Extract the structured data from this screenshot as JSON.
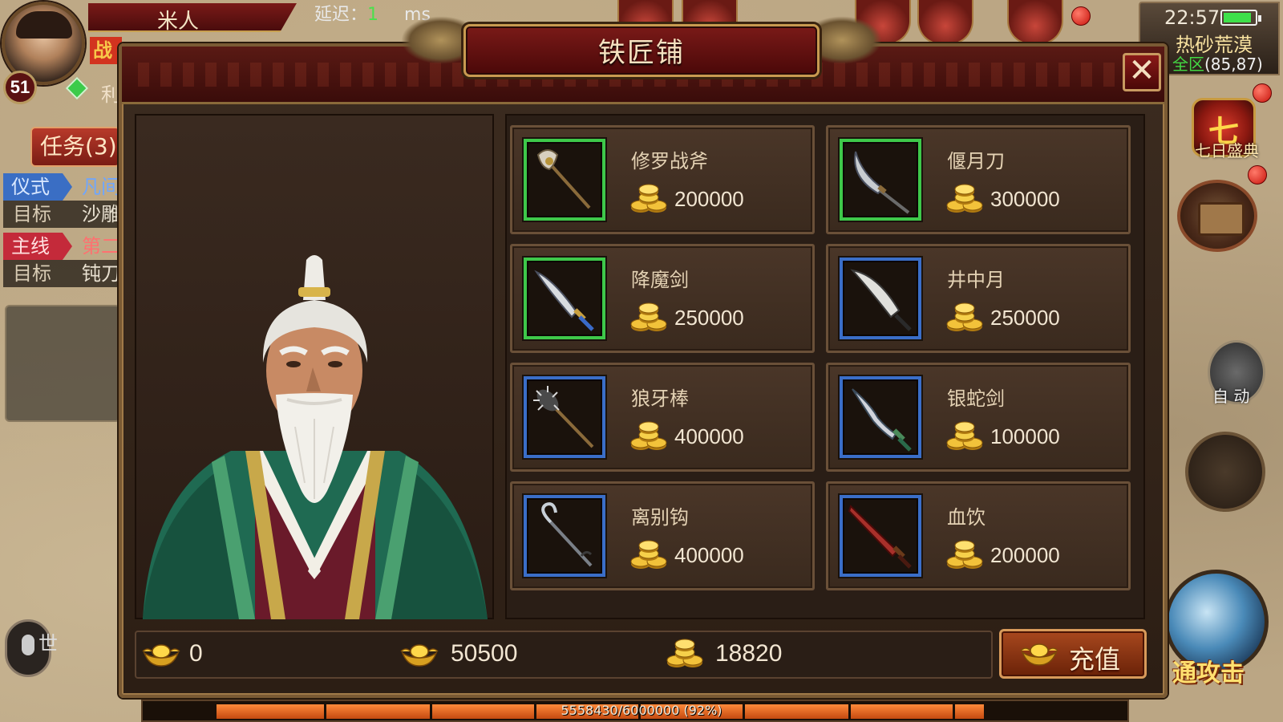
{
  "hud": {
    "player_name": "米人",
    "level": "51",
    "red_tag": "战",
    "small_text": "利",
    "latency_label": "延迟：",
    "latency_value": "1",
    "latency_unit": "ms",
    "task_button": "任务(3)",
    "quests": [
      {
        "tag": "仪式",
        "tag_color": "blue",
        "value": "凡间",
        "target_label": "目标",
        "target": "沙雕"
      },
      {
        "tag": "主线",
        "tag_color": "red",
        "value": "第二",
        "target_label": "目标",
        "target": "钝刀"
      }
    ],
    "voice_label": "世",
    "clock": "22:57",
    "battery_level": 0.9,
    "zone_name": "热砂荒漠",
    "zone_scope": "全区",
    "zone_coords": "(85,87)",
    "event_glyph": "七",
    "event_label": "七日盛典",
    "auto_label": "自 动",
    "attack_label": "通攻击"
  },
  "dialog": {
    "title": "铁匠铺",
    "close_label": "✕",
    "items": [
      {
        "name": "修罗战斧",
        "price": "200000",
        "rarity": "green",
        "icon": "battle-axe-icon"
      },
      {
        "name": "偃月刀",
        "price": "300000",
        "rarity": "green",
        "icon": "crescent-blade-icon"
      },
      {
        "name": "降魔剑",
        "price": "250000",
        "rarity": "green",
        "icon": "curved-sword-icon"
      },
      {
        "name": "井中月",
        "price": "250000",
        "rarity": "blue",
        "icon": "broadsword-icon"
      },
      {
        "name": "狼牙棒",
        "price": "400000",
        "rarity": "blue",
        "icon": "spiked-mace-icon"
      },
      {
        "name": "银蛇剑",
        "price": "100000",
        "rarity": "blue",
        "icon": "serpent-sword-icon"
      },
      {
        "name": "离别钩",
        "price": "400000",
        "rarity": "blue",
        "icon": "hook-blade-icon"
      },
      {
        "name": "血饮",
        "price": "200000",
        "rarity": "blue",
        "icon": "blood-sword-icon"
      }
    ],
    "currencies": [
      {
        "name": "ingot",
        "icon": "gold-ingot-icon",
        "value": "0"
      },
      {
        "name": "bound-ingot",
        "icon": "bound-ingot-icon",
        "value": "50500"
      },
      {
        "name": "gold",
        "icon": "gold-coins-icon",
        "value": "18820"
      }
    ],
    "recharge_label": "充值"
  },
  "exp": {
    "text": "5558430/6000000 (92%)",
    "fraction": 0.92
  },
  "colors": {
    "rarity_green": "#3ec84a",
    "rarity_blue": "#3a6ec8",
    "panel_bg": "#3a2a1e",
    "title_red": "#7a1a18"
  }
}
